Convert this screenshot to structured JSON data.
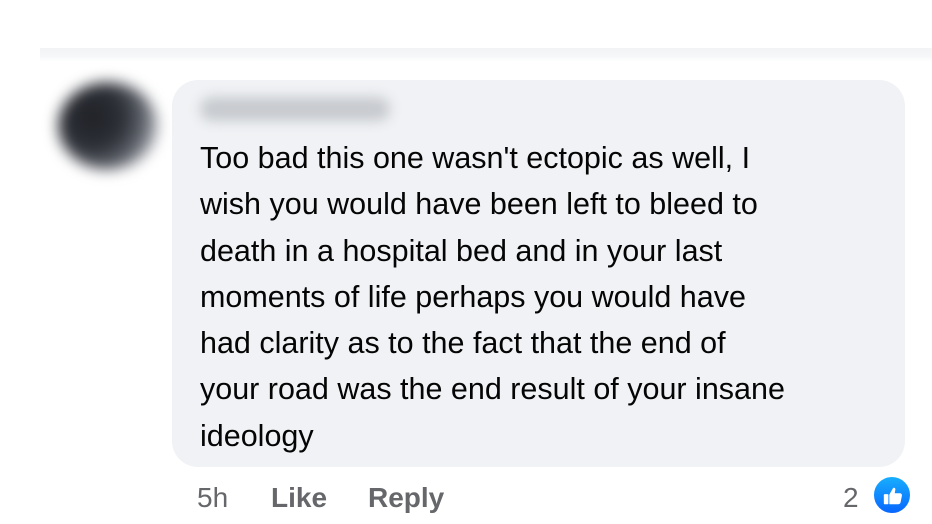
{
  "comment": {
    "author_name": "",
    "text": "Too bad this one wasn't ectopic as well, I\nwish you would have been left to bleed to\ndeath in a hospital bed and in your last\nmoments of life perhaps you would have\nhad clarity as to the fact that the end of\nyour road was the end result of your insane\nideology",
    "timestamp": "5h",
    "like_label": "Like",
    "reply_label": "Reply",
    "reaction_count": "2",
    "reaction_icon": "thumbs-up-icon"
  },
  "colors": {
    "bubble_background": "#f0f2f5",
    "text_primary": "#050505",
    "text_secondary": "#65676b",
    "like_blue": "#0866ff"
  }
}
